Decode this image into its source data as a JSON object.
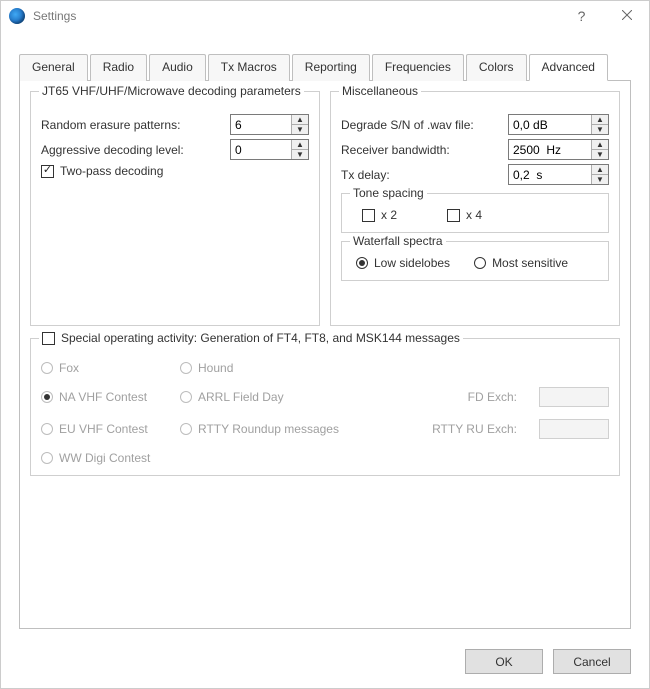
{
  "window": {
    "title": "Settings",
    "help_glyph": "?",
    "close_glyph": "✕"
  },
  "tabs": [
    "General",
    "Radio",
    "Audio",
    "Tx Macros",
    "Reporting",
    "Frequencies",
    "Colors",
    "Advanced"
  ],
  "active_tab_index": 7,
  "jt65": {
    "legend": "JT65 VHF/UHF/Microwave decoding parameters",
    "erasure_label": "Random erasure patterns:",
    "erasure_value": "6",
    "aggressive_label": "Aggressive decoding level:",
    "aggressive_value": "0",
    "two_pass_label": "Two-pass decoding",
    "two_pass_checked": true
  },
  "misc": {
    "legend": "Miscellaneous",
    "degrade_label": "Degrade S/N of .wav file:",
    "degrade_value": "0,0 dB",
    "bandwidth_label": "Receiver bandwidth:",
    "bandwidth_value": "2500  Hz",
    "txdelay_label": "Tx delay:",
    "txdelay_value": "0,2  s",
    "tone_legend": "Tone spacing",
    "x2_label": "x 2",
    "x4_label": "x 4",
    "waterfall_legend": "Waterfall spectra",
    "low_label": "Low sidelobes",
    "sensitive_label": "Most sensitive",
    "waterfall_choice": "low"
  },
  "special": {
    "enable_label": "Special operating activity:  Generation of FT4, FT8, and MSK144 messages",
    "enabled": false,
    "options": {
      "fox": "Fox",
      "hound": "Hound",
      "na_vhf": "NA VHF Contest",
      "arrl_fd": "ARRL Field Day",
      "eu_vhf": "EU VHF Contest",
      "rtty": "RTTY Roundup messages",
      "ww_digi": "WW Digi Contest"
    },
    "selected": "na_vhf",
    "fd_exch_label": "FD Exch:",
    "fd_exch_value": "",
    "rtty_exch_label": "RTTY RU Exch:",
    "rtty_exch_value": ""
  },
  "buttons": {
    "ok": "OK",
    "cancel": "Cancel"
  }
}
